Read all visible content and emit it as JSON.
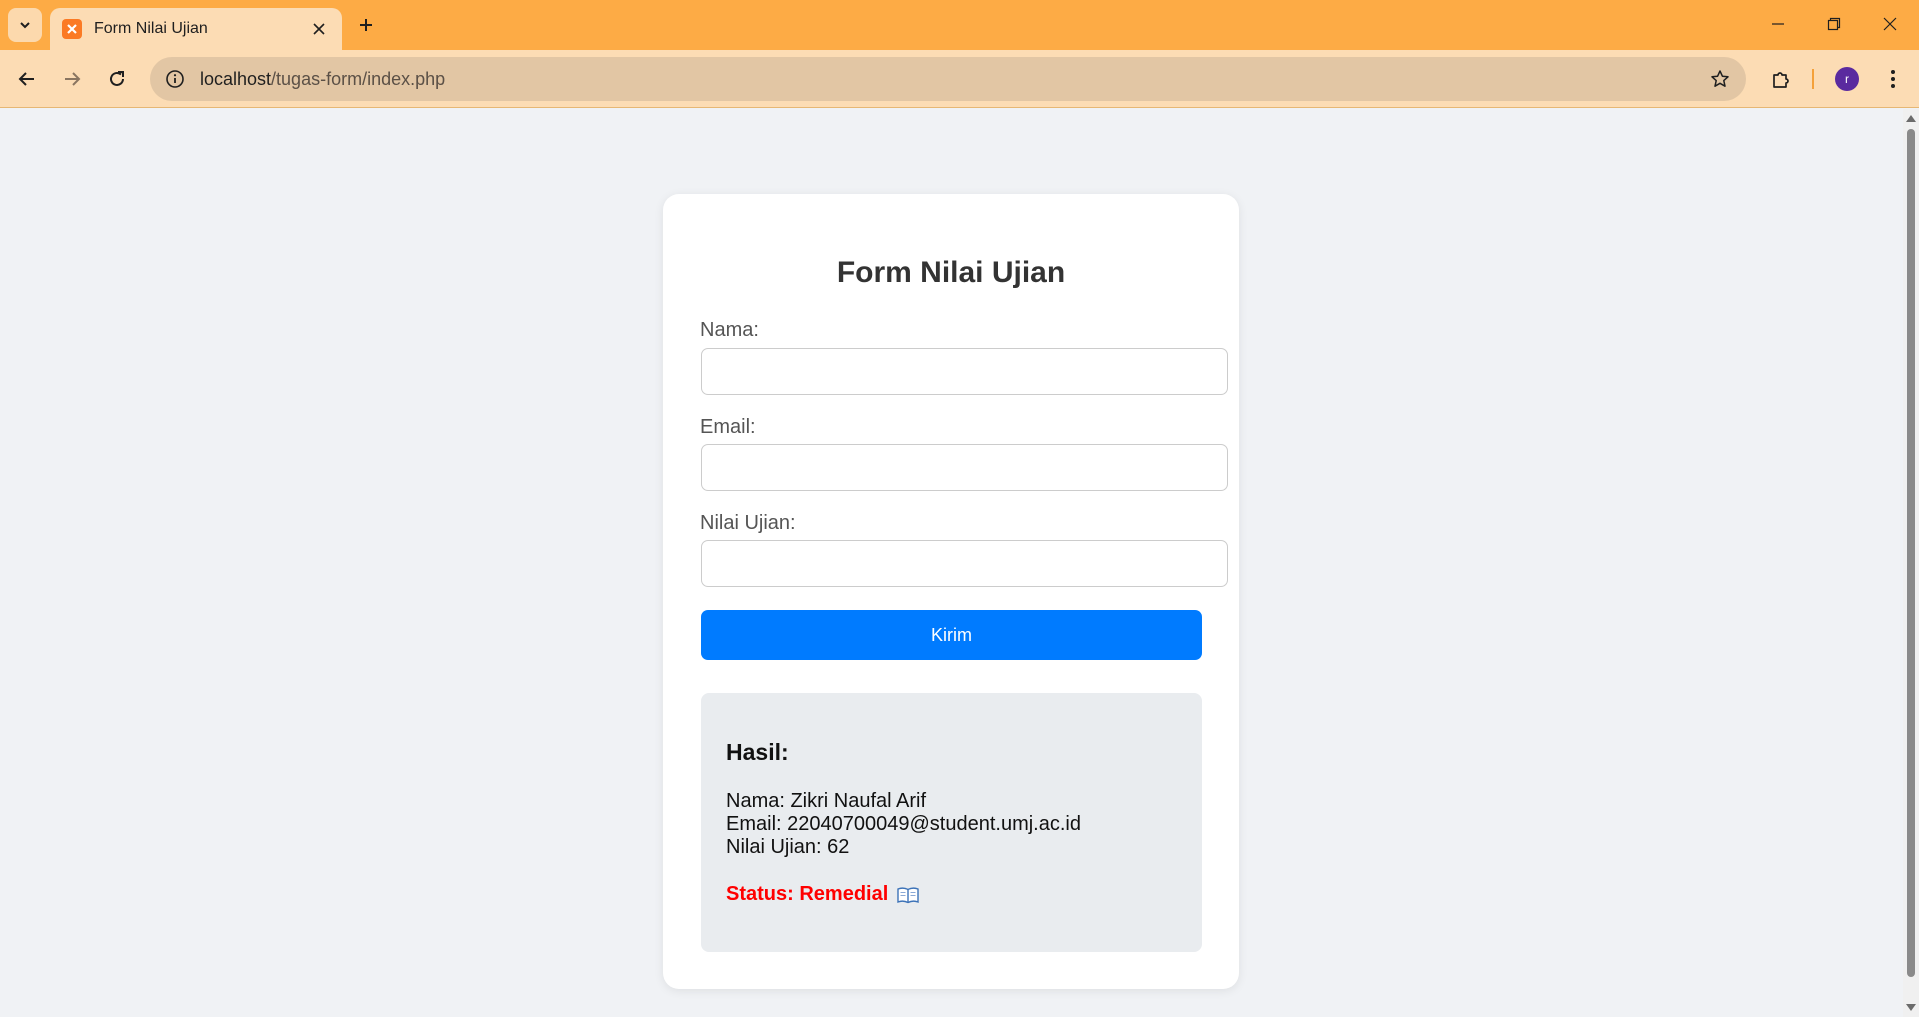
{
  "browser": {
    "tab_title": "Form Nilai Ujian",
    "url_host": "localhost",
    "url_path": "/tugas-form/index.php",
    "avatar_initial": "r",
    "accent_color": "#fdab45"
  },
  "form": {
    "title": "Form Nilai Ujian",
    "nama_label": "Nama:",
    "nama_value": "",
    "email_label": "Email:",
    "email_value": "",
    "nilai_label": "Nilai Ujian:",
    "nilai_value": "",
    "submit_label": "Kirim",
    "submit_color": "#007bff"
  },
  "result": {
    "heading": "Hasil:",
    "nama_line": "Nama: Zikri Naufal Arif",
    "email_line": "Email: 22040700049@student.umj.ac.id",
    "nilai_line": "Nilai Ujian: 62",
    "status_text": "Status: Remedial",
    "status_color": "#ff0000",
    "status_icon": "open-book-icon"
  }
}
